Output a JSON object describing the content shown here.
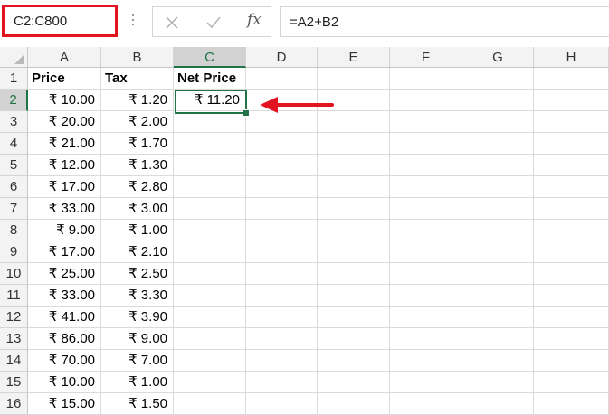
{
  "formula_bar": {
    "name_box": "C2:C800",
    "cancel_icon": "close-x-icon",
    "enter_icon": "checkmark-icon",
    "fx_label": "fx",
    "formula": "=A2+B2"
  },
  "columns": [
    "A",
    "B",
    "C",
    "D",
    "E",
    "F",
    "G",
    "H"
  ],
  "selected_column": "C",
  "selected_row": "2",
  "rows": [
    {
      "num": "1",
      "a": "Price",
      "b": "Tax",
      "c": "Net Price"
    },
    {
      "num": "2",
      "a": "₹ 10.00",
      "b": "₹ 1.20",
      "c": "₹ 11.20"
    },
    {
      "num": "3",
      "a": "₹ 20.00",
      "b": "₹ 2.00",
      "c": ""
    },
    {
      "num": "4",
      "a": "₹ 21.00",
      "b": "₹ 1.70",
      "c": ""
    },
    {
      "num": "5",
      "a": "₹ 12.00",
      "b": "₹ 1.30",
      "c": ""
    },
    {
      "num": "6",
      "a": "₹ 17.00",
      "b": "₹ 2.80",
      "c": ""
    },
    {
      "num": "7",
      "a": "₹ 33.00",
      "b": "₹ 3.00",
      "c": ""
    },
    {
      "num": "8",
      "a": "₹ 9.00",
      "b": "₹ 1.00",
      "c": ""
    },
    {
      "num": "9",
      "a": "₹ 17.00",
      "b": "₹ 2.10",
      "c": ""
    },
    {
      "num": "10",
      "a": "₹ 25.00",
      "b": "₹ 2.50",
      "c": ""
    },
    {
      "num": "11",
      "a": "₹ 33.00",
      "b": "₹ 3.30",
      "c": ""
    },
    {
      "num": "12",
      "a": "₹ 41.00",
      "b": "₹ 3.90",
      "c": ""
    },
    {
      "num": "13",
      "a": "₹ 86.00",
      "b": "₹ 9.00",
      "c": ""
    },
    {
      "num": "14",
      "a": "₹ 70.00",
      "b": "₹ 7.00",
      "c": ""
    },
    {
      "num": "15",
      "a": "₹ 10.00",
      "b": "₹ 1.00",
      "c": ""
    },
    {
      "num": "16",
      "a": "₹ 15.00",
      "b": "₹ 1.50",
      "c": ""
    }
  ],
  "colors": {
    "accent": "#217346",
    "highlight": "#e2141f"
  }
}
